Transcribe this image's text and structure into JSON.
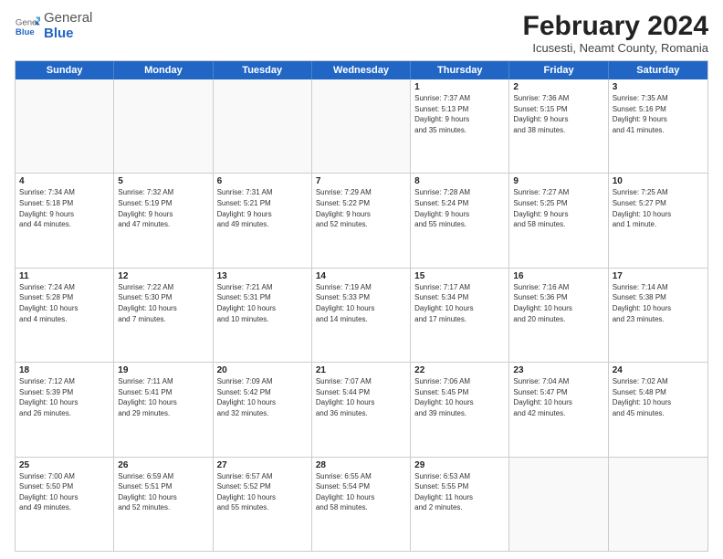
{
  "logo": {
    "general": "General",
    "blue": "Blue"
  },
  "title": "February 2024",
  "subtitle": "Icusesti, Neamt County, Romania",
  "calendar": {
    "headers": [
      "Sunday",
      "Monday",
      "Tuesday",
      "Wednesday",
      "Thursday",
      "Friday",
      "Saturday"
    ],
    "weeks": [
      [
        {
          "day": "",
          "info": ""
        },
        {
          "day": "",
          "info": ""
        },
        {
          "day": "",
          "info": ""
        },
        {
          "day": "",
          "info": ""
        },
        {
          "day": "1",
          "info": "Sunrise: 7:37 AM\nSunset: 5:13 PM\nDaylight: 9 hours\nand 35 minutes."
        },
        {
          "day": "2",
          "info": "Sunrise: 7:36 AM\nSunset: 5:15 PM\nDaylight: 9 hours\nand 38 minutes."
        },
        {
          "day": "3",
          "info": "Sunrise: 7:35 AM\nSunset: 5:16 PM\nDaylight: 9 hours\nand 41 minutes."
        }
      ],
      [
        {
          "day": "4",
          "info": "Sunrise: 7:34 AM\nSunset: 5:18 PM\nDaylight: 9 hours\nand 44 minutes."
        },
        {
          "day": "5",
          "info": "Sunrise: 7:32 AM\nSunset: 5:19 PM\nDaylight: 9 hours\nand 47 minutes."
        },
        {
          "day": "6",
          "info": "Sunrise: 7:31 AM\nSunset: 5:21 PM\nDaylight: 9 hours\nand 49 minutes."
        },
        {
          "day": "7",
          "info": "Sunrise: 7:29 AM\nSunset: 5:22 PM\nDaylight: 9 hours\nand 52 minutes."
        },
        {
          "day": "8",
          "info": "Sunrise: 7:28 AM\nSunset: 5:24 PM\nDaylight: 9 hours\nand 55 minutes."
        },
        {
          "day": "9",
          "info": "Sunrise: 7:27 AM\nSunset: 5:25 PM\nDaylight: 9 hours\nand 58 minutes."
        },
        {
          "day": "10",
          "info": "Sunrise: 7:25 AM\nSunset: 5:27 PM\nDaylight: 10 hours\nand 1 minute."
        }
      ],
      [
        {
          "day": "11",
          "info": "Sunrise: 7:24 AM\nSunset: 5:28 PM\nDaylight: 10 hours\nand 4 minutes."
        },
        {
          "day": "12",
          "info": "Sunrise: 7:22 AM\nSunset: 5:30 PM\nDaylight: 10 hours\nand 7 minutes."
        },
        {
          "day": "13",
          "info": "Sunrise: 7:21 AM\nSunset: 5:31 PM\nDaylight: 10 hours\nand 10 minutes."
        },
        {
          "day": "14",
          "info": "Sunrise: 7:19 AM\nSunset: 5:33 PM\nDaylight: 10 hours\nand 14 minutes."
        },
        {
          "day": "15",
          "info": "Sunrise: 7:17 AM\nSunset: 5:34 PM\nDaylight: 10 hours\nand 17 minutes."
        },
        {
          "day": "16",
          "info": "Sunrise: 7:16 AM\nSunset: 5:36 PM\nDaylight: 10 hours\nand 20 minutes."
        },
        {
          "day": "17",
          "info": "Sunrise: 7:14 AM\nSunset: 5:38 PM\nDaylight: 10 hours\nand 23 minutes."
        }
      ],
      [
        {
          "day": "18",
          "info": "Sunrise: 7:12 AM\nSunset: 5:39 PM\nDaylight: 10 hours\nand 26 minutes."
        },
        {
          "day": "19",
          "info": "Sunrise: 7:11 AM\nSunset: 5:41 PM\nDaylight: 10 hours\nand 29 minutes."
        },
        {
          "day": "20",
          "info": "Sunrise: 7:09 AM\nSunset: 5:42 PM\nDaylight: 10 hours\nand 32 minutes."
        },
        {
          "day": "21",
          "info": "Sunrise: 7:07 AM\nSunset: 5:44 PM\nDaylight: 10 hours\nand 36 minutes."
        },
        {
          "day": "22",
          "info": "Sunrise: 7:06 AM\nSunset: 5:45 PM\nDaylight: 10 hours\nand 39 minutes."
        },
        {
          "day": "23",
          "info": "Sunrise: 7:04 AM\nSunset: 5:47 PM\nDaylight: 10 hours\nand 42 minutes."
        },
        {
          "day": "24",
          "info": "Sunrise: 7:02 AM\nSunset: 5:48 PM\nDaylight: 10 hours\nand 45 minutes."
        }
      ],
      [
        {
          "day": "25",
          "info": "Sunrise: 7:00 AM\nSunset: 5:50 PM\nDaylight: 10 hours\nand 49 minutes."
        },
        {
          "day": "26",
          "info": "Sunrise: 6:59 AM\nSunset: 5:51 PM\nDaylight: 10 hours\nand 52 minutes."
        },
        {
          "day": "27",
          "info": "Sunrise: 6:57 AM\nSunset: 5:52 PM\nDaylight: 10 hours\nand 55 minutes."
        },
        {
          "day": "28",
          "info": "Sunrise: 6:55 AM\nSunset: 5:54 PM\nDaylight: 10 hours\nand 58 minutes."
        },
        {
          "day": "29",
          "info": "Sunrise: 6:53 AM\nSunset: 5:55 PM\nDaylight: 11 hours\nand 2 minutes."
        },
        {
          "day": "",
          "info": ""
        },
        {
          "day": "",
          "info": ""
        }
      ]
    ]
  }
}
